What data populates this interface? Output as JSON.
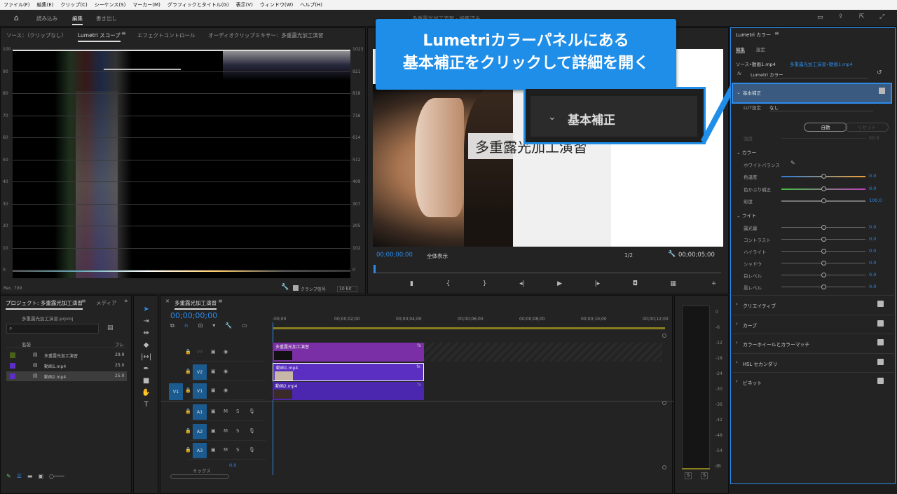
{
  "menu": [
    "ファイル(F)",
    "編集(E)",
    "クリップ(C)",
    "シーケンス(S)",
    "マーカー(M)",
    "グラフィックとタイトル(G)",
    "表示(V)",
    "ウィンドウ(W)",
    "ヘルプ(H)"
  ],
  "workspace": {
    "tabs": [
      "読み込み",
      "編集",
      "書き出し"
    ],
    "title": "多重露光加工演習 - 編集済み"
  },
  "source_panel": {
    "tabs": [
      "ソース：（クリップなし）",
      "Lumetri スコープ",
      "エフェクトコントロール",
      "オーディオクリップミキサー：多重露光加工演習"
    ],
    "left_ticks": [
      "100",
      "90",
      "80",
      "70",
      "60",
      "50",
      "40",
      "30",
      "20",
      "10",
      "0"
    ],
    "right_ticks": [
      "1023",
      "921",
      "818",
      "716",
      "614",
      "512",
      "409",
      "307",
      "205",
      "102",
      "0"
    ],
    "bottom_left": "Rec. 709",
    "clamp_label": "クランプ信号",
    "bit_label": "10 bit"
  },
  "program": {
    "timecode": "00;00;00;00",
    "fit": "全体表示",
    "zoom": "1/2",
    "duration": "00;00;05;00",
    "title_overlay": "多重露光加工演習"
  },
  "callout": {
    "line1": "Lumetriカラーパネルにある",
    "line2": "基本補正をクリックして詳細を開く"
  },
  "zoom_label": "基本補正",
  "project": {
    "tab": "プロジェクト: 多重露光加工演習",
    "media_tab": "メディア",
    "file": "多重露光加工演習.prproj",
    "col_name": "名前",
    "col_fps": "フレ",
    "items": [
      {
        "name": "多重露光加工演習",
        "fps": "29.9",
        "color": "#4c6118"
      },
      {
        "name": "動画1.mp4",
        "fps": "25.0",
        "color": "#5b2fc2"
      },
      {
        "name": "動画2.mp4",
        "fps": "25.0",
        "color": "#5b2fc2"
      }
    ]
  },
  "timeline": {
    "tab": "多重露光加工演習",
    "timecode": "00;00;00;00",
    "ruler": [
      ":00;00",
      "00;00;02;00",
      "00;00;04;00",
      "00;00;06;00",
      "00;00;08;00",
      "00;00;10;00",
      "00;00;12;00"
    ],
    "tracks_v": [
      "V3",
      "V2",
      "V1"
    ],
    "tracks_a": [
      "A1",
      "A2",
      "A3"
    ],
    "src_v": "V1",
    "mix_label": "ミックス",
    "mix_val": "0.0",
    "clip_v3": "多重露光加工演習",
    "clip_v2": "動画1.mp4",
    "clip_v1": "動画2.mp4",
    "clip_fx": "fx"
  },
  "meter": {
    "ticks": [
      "0",
      "-6",
      "-12",
      "-18",
      "-24",
      "-30",
      "-36",
      "-42",
      "-48",
      "-54",
      "dB"
    ],
    "solo": [
      "S",
      "S"
    ]
  },
  "lumetri": {
    "tab": "Lumetri カラー",
    "subtabs": [
      "編集",
      "設定"
    ],
    "source": "ソース•動画1.mp4",
    "seq": "多重露光加工演習•動画1.mp4",
    "fx_label": "Lumetri カラー",
    "basic": "基本補正",
    "lut_label": "LUT設定",
    "lut_val": "なし",
    "auto": "自動",
    "reset": "リセット",
    "intensity": "強度",
    "intensity_val": "50.0",
    "color": "カラー",
    "wb": "ホワイトバランス",
    "temp": "色温度",
    "tint": "色かぶり補正",
    "sat": "彩度",
    "temp_val": "0.0",
    "tint_val": "0.0",
    "sat_val": "100.0",
    "light": "ライト",
    "light_rows": [
      "露光量",
      "コントラスト",
      "ハイライト",
      "シャドウ",
      "白レベル",
      "黒レベル"
    ],
    "light_val": "0.0",
    "sections": [
      "クリエイティブ",
      "カーブ",
      "カラーホイールとカラーマッチ",
      "HSL セカンダリ",
      "ビネット"
    ]
  },
  "colors": {
    "accent": "#2d8ceb",
    "callout": "#1e8ee8",
    "clip_purple": "#5b2fc2",
    "seq_purple": "#7b2fa6"
  }
}
